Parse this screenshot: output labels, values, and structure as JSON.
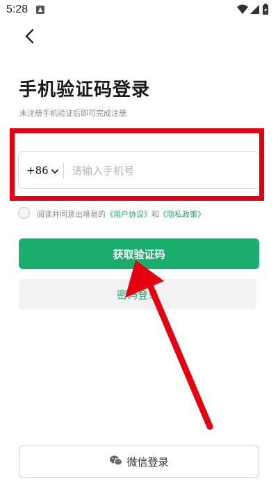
{
  "status_bar": {
    "time": "5:28"
  },
  "page": {
    "title": "手机验证码登录",
    "subtitle": "未注册手机验证后即可完成注册"
  },
  "phone_field": {
    "country_code": "+86",
    "placeholder": "请输入手机号",
    "value": ""
  },
  "agreement": {
    "prefix": "阅读并同意出境易的",
    "user_agreement": "《用户协议》",
    "and": "和",
    "privacy_policy": "《隐私政策》",
    "checked": false
  },
  "buttons": {
    "get_code": "获取验证码",
    "password_login": "密码登录",
    "wechat_login": "微信登录"
  },
  "colors": {
    "brand_green": "#1aad6d",
    "highlight_red": "#e6000f"
  },
  "icons": [
    "back-arrow-icon",
    "chevron-down-icon",
    "wechat-icon",
    "wifi-icon",
    "signal-icon",
    "battery-icon"
  ]
}
